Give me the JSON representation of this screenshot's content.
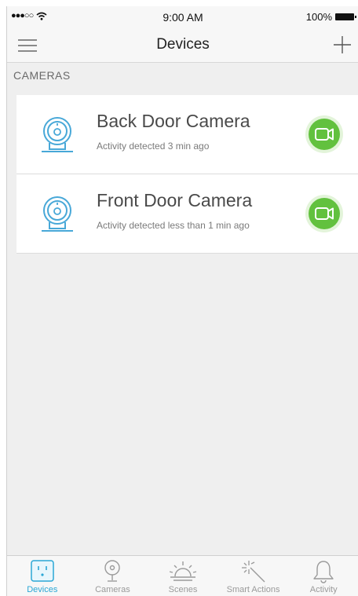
{
  "status_bar": {
    "signal": "●●●○○",
    "time": "9:00 AM",
    "battery": "100%"
  },
  "nav": {
    "title": "Devices",
    "menu_icon": "hamburger-menu-icon",
    "add_icon": "plus-icon"
  },
  "section": {
    "header": "CAMERAS"
  },
  "devices": [
    {
      "name": "Back Door Camera",
      "status": "Activity detected 3 min ago",
      "icon": "camera-icon",
      "action_icon": "video-icon"
    },
    {
      "name": "Front Door Camera",
      "status": "Activity detected less than 1 min ago",
      "icon": "camera-icon",
      "action_icon": "video-icon"
    }
  ],
  "tabs": [
    {
      "label": "Devices",
      "icon": "outlet-icon",
      "active": true
    },
    {
      "label": "Cameras",
      "icon": "camera-icon",
      "active": false
    },
    {
      "label": "Scenes",
      "icon": "sunrise-icon",
      "active": false
    },
    {
      "label": "Smart Actions",
      "icon": "magic-wand-icon",
      "active": false
    },
    {
      "label": "Activity",
      "icon": "bell-icon",
      "active": false
    }
  ],
  "colors": {
    "accent": "#2aa7d5",
    "camera_icon": "#48a8d8",
    "video_button": "#62c13e",
    "tab_inactive": "#9a9a9a"
  }
}
